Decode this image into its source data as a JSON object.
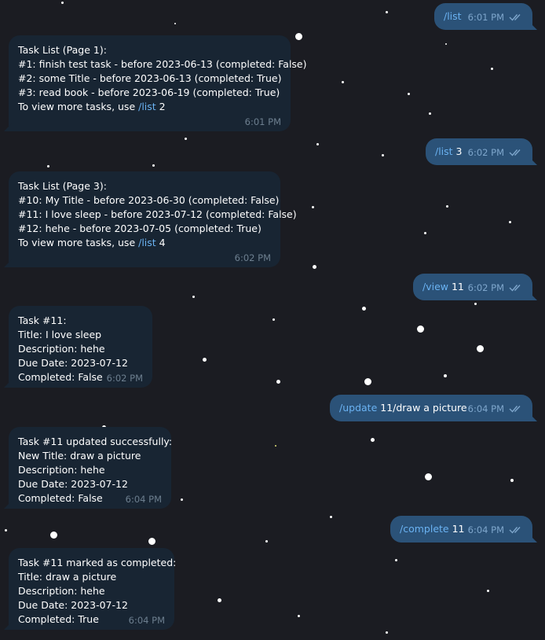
{
  "colors": {
    "background": "#1b1c22",
    "outgoing_bubble": "#2b5278",
    "incoming_bubble": "#182533",
    "command_link": "#6ab2f2",
    "time_incoming": "#6d7f8f",
    "time_outgoing": "#7ea6cc"
  },
  "icons": {
    "read_receipt": "double-check-icon"
  },
  "messages": [
    {
      "direction": "out",
      "command": "/list",
      "arg": "",
      "time": "6:01 PM"
    },
    {
      "direction": "in",
      "lines": [
        "Task List (Page 1):",
        "#1: finish test task - before 2023-06-13 (completed: False)",
        "#2: some Title - before 2023-06-13 (completed: True)",
        "#3: read book - before 2023-06-19 (completed: True)",
        ""
      ],
      "footer_prefix": "To view more tasks, use ",
      "footer_command": "/list",
      "footer_arg": " 2",
      "time": "6:01 PM"
    },
    {
      "direction": "out",
      "command": "/list",
      "arg": " 3",
      "time": "6:02 PM"
    },
    {
      "direction": "in",
      "lines": [
        "Task List (Page 3):",
        "#10: My Title - before 2023-06-30 (completed: False)",
        "#11: I love sleep - before 2023-07-12 (completed: False)",
        "#12: hehe - before 2023-07-05 (completed: True)",
        ""
      ],
      "footer_prefix": "To view more tasks, use ",
      "footer_command": "/list",
      "footer_arg": " 4",
      "time": "6:02 PM"
    },
    {
      "direction": "out",
      "command": "/view",
      "arg": " 11",
      "time": "6:02 PM"
    },
    {
      "direction": "in",
      "lines": [
        "Task #11:",
        "Title: I love sleep",
        "Description: hehe",
        "Due Date: 2023-07-12",
        "Completed: False"
      ],
      "time": "6:02 PM"
    },
    {
      "direction": "out",
      "command": "/update",
      "arg": " 11/draw a picture",
      "time": "6:04 PM"
    },
    {
      "direction": "in",
      "lines": [
        "Task #11 updated successfully:",
        "New Title: draw a picture",
        "Description: hehe",
        "Due Date: 2023-07-12",
        "Completed: False"
      ],
      "time": "6:04 PM"
    },
    {
      "direction": "out",
      "command": "/complete",
      "arg": " 11",
      "time": "6:04 PM"
    },
    {
      "direction": "in",
      "lines": [
        "Task #11 marked as completed:",
        "Title: draw a picture",
        "Description: hehe",
        "Due Date: 2023-07-12",
        "Completed: True"
      ],
      "time": "6:04 PM"
    }
  ]
}
